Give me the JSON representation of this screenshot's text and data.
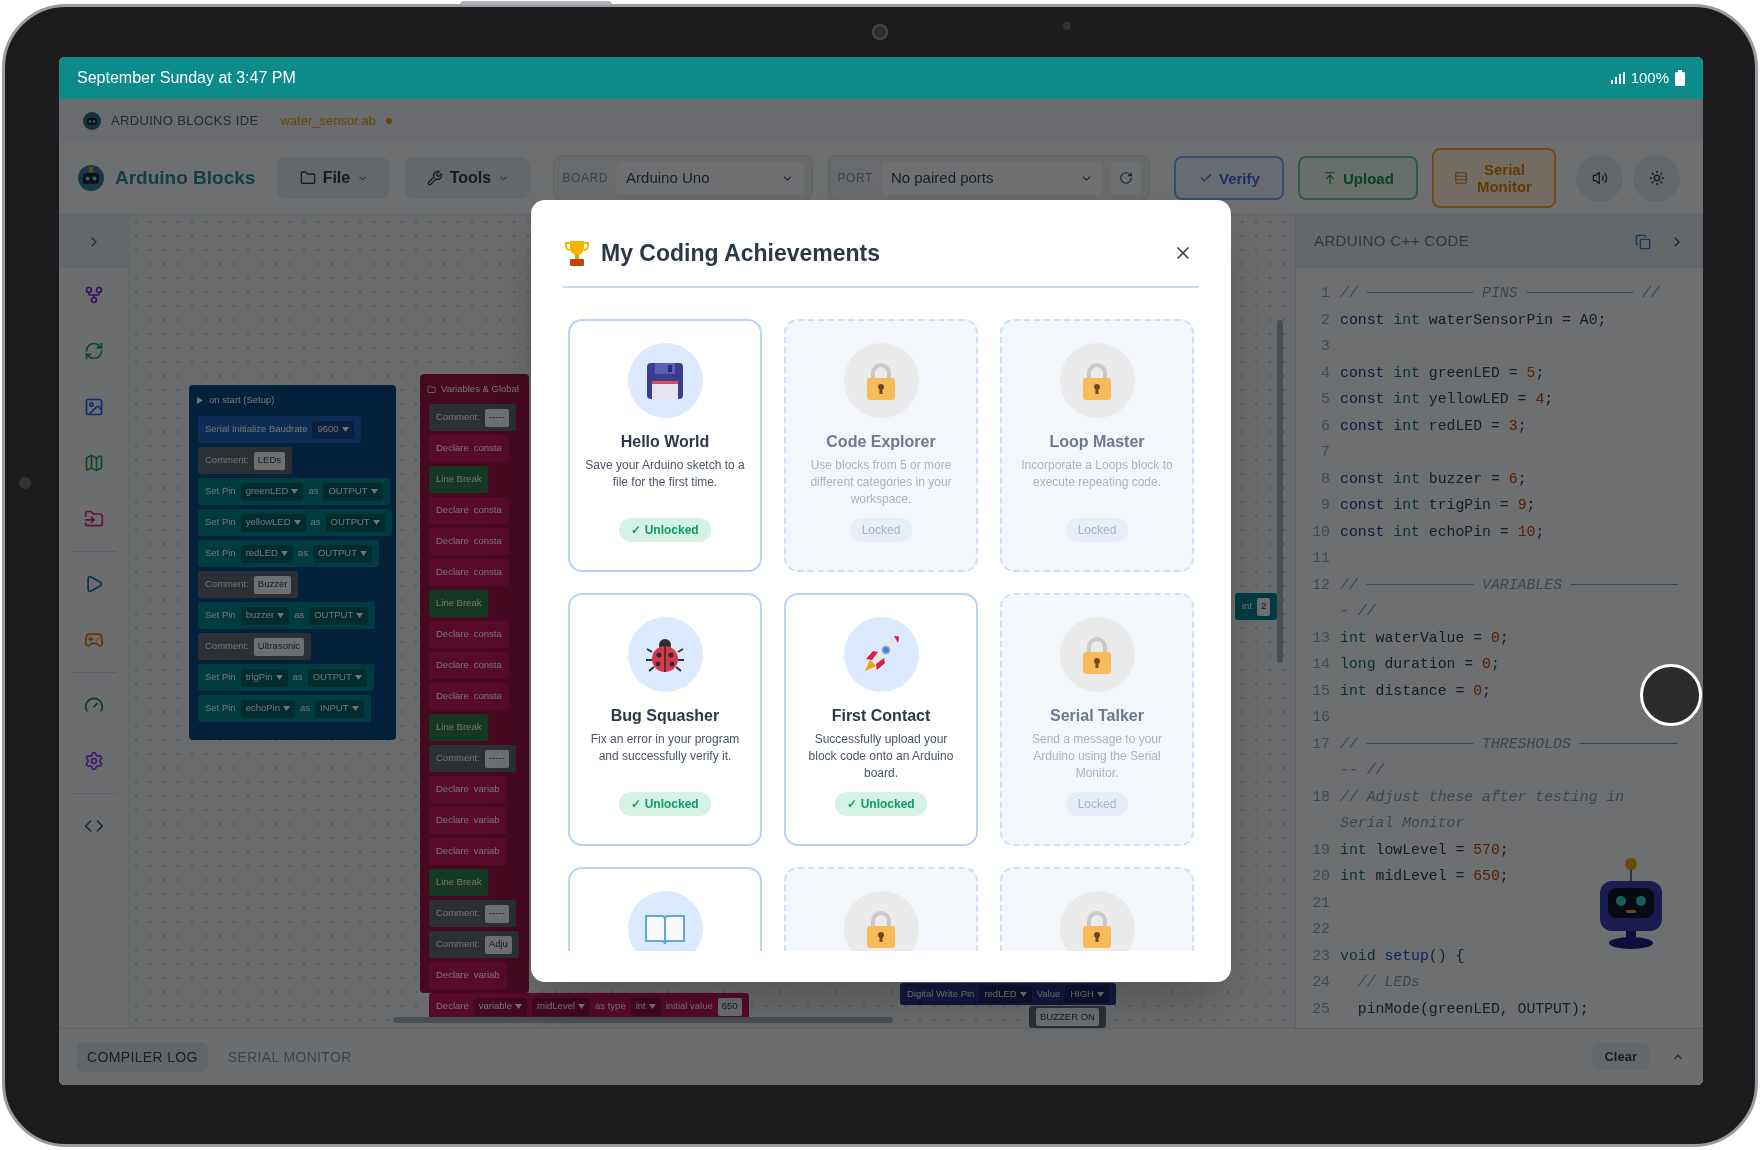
{
  "status_bar": {
    "time": "September Sunday at 3:47 PM",
    "battery": "100%"
  },
  "ide_header": {
    "title": "ARDUINO BLOCKS IDE",
    "file": "water_sensor.ab",
    "modified": true
  },
  "toolbar": {
    "app_name": "Arduino Blocks",
    "menus": [
      {
        "label": "File",
        "kind": "file"
      },
      {
        "label": "Tools",
        "kind": "tools"
      }
    ],
    "board": {
      "label": "BOARD",
      "value": "Arduino Uno"
    },
    "port": {
      "label": "PORT",
      "value": "No paired ports"
    },
    "actions": [
      {
        "label": "Verify",
        "kind": "verify"
      },
      {
        "label": "Upload",
        "kind": "upload"
      },
      {
        "label": "Serial Monitor",
        "kind": "serial"
      }
    ]
  },
  "workspace": {
    "setup_block": {
      "title": "on start (Setup)",
      "rows": [
        {
          "kind": "serial",
          "parts": [
            {
              "text": "Serial Initialize Baudrate"
            },
            {
              "text": "9600",
              "kind": "dropdown"
            }
          ]
        },
        {
          "kind": "comment",
          "parts": [
            {
              "text": "Comment:"
            },
            {
              "text": "LEDs",
              "kind": "field"
            }
          ]
        },
        {
          "kind": "pin",
          "parts": [
            {
              "text": "Set Pin"
            },
            {
              "text": "greenLED",
              "kind": "dropdown"
            },
            {
              "text": "as"
            },
            {
              "text": "OUTPUT",
              "kind": "dropdown"
            }
          ]
        },
        {
          "kind": "pin",
          "parts": [
            {
              "text": "Set Pin"
            },
            {
              "text": "yellowLED",
              "kind": "dropdown"
            },
            {
              "text": "as"
            },
            {
              "text": "OUTPUT",
              "kind": "dropdown"
            }
          ]
        },
        {
          "kind": "pin",
          "parts": [
            {
              "text": "Set Pin"
            },
            {
              "text": "redLED",
              "kind": "dropdown"
            },
            {
              "text": "as"
            },
            {
              "text": "OUTPUT",
              "kind": "dropdown"
            }
          ]
        },
        {
          "kind": "comment",
          "parts": [
            {
              "text": "Comment:"
            },
            {
              "text": "Buzzer",
              "kind": "field"
            }
          ]
        },
        {
          "kind": "pin",
          "parts": [
            {
              "text": "Set Pin"
            },
            {
              "text": "buzzer",
              "kind": "dropdown"
            },
            {
              "text": "as"
            },
            {
              "text": "OUTPUT",
              "kind": "dropdown"
            }
          ]
        },
        {
          "kind": "comment",
          "parts": [
            {
              "text": "Comment:"
            },
            {
              "text": "Ultrasonic",
              "kind": "field"
            }
          ]
        },
        {
          "kind": "pin",
          "parts": [
            {
              "text": "Set Pin"
            },
            {
              "text": "trigPin",
              "kind": "dropdown"
            },
            {
              "text": "as"
            },
            {
              "text": "OUTPUT",
              "kind": "dropdown"
            }
          ]
        },
        {
          "kind": "pin",
          "parts": [
            {
              "text": "Set Pin"
            },
            {
              "text": "echoPin",
              "kind": "dropdown"
            },
            {
              "text": "as"
            },
            {
              "text": "INPUT",
              "kind": "dropdown"
            }
          ]
        }
      ]
    },
    "globals_block": {
      "title": "Variables & Global",
      "rows": [
        {
          "kind": "comment",
          "parts": [
            {
              "text": "Comment:"
            },
            {
              "text": "-----",
              "kind": "field"
            }
          ]
        },
        {
          "kind": "declare",
          "parts": [
            {
              "text": "Declare"
            },
            {
              "text": "consta"
            }
          ]
        },
        {
          "kind": "line_break",
          "parts": [
            {
              "text": "Line Break"
            }
          ]
        },
        {
          "kind": "declare",
          "parts": [
            {
              "text": "Declare"
            },
            {
              "text": "consta"
            }
          ]
        },
        {
          "kind": "declare",
          "parts": [
            {
              "text": "Declare"
            },
            {
              "text": "consta"
            }
          ]
        },
        {
          "kind": "declare",
          "parts": [
            {
              "text": "Declare"
            },
            {
              "text": "consta"
            }
          ]
        },
        {
          "kind": "line_break",
          "parts": [
            {
              "text": "Line Break"
            }
          ]
        },
        {
          "kind": "declare",
          "parts": [
            {
              "text": "Declare"
            },
            {
              "text": "consta"
            }
          ]
        },
        {
          "kind": "declare",
          "parts": [
            {
              "text": "Declare"
            },
            {
              "text": "consta"
            }
          ]
        },
        {
          "kind": "declare",
          "parts": [
            {
              "text": "Declare"
            },
            {
              "text": "consta"
            }
          ]
        },
        {
          "kind": "line_break",
          "parts": [
            {
              "text": "Line Break"
            }
          ]
        },
        {
          "kind": "comment",
          "parts": [
            {
              "text": "Comment:"
            },
            {
              "text": "-----",
              "kind": "field"
            }
          ]
        },
        {
          "kind": "declare",
          "parts": [
            {
              "text": "Declare"
            },
            {
              "text": "variab"
            }
          ]
        },
        {
          "kind": "declare",
          "parts": [
            {
              "text": "Declare"
            },
            {
              "text": "variab"
            }
          ]
        },
        {
          "kind": "declare",
          "parts": [
            {
              "text": "Declare"
            },
            {
              "text": "variab"
            }
          ]
        },
        {
          "kind": "line_break",
          "parts": [
            {
              "text": "Line Break"
            }
          ]
        },
        {
          "kind": "comment",
          "parts": [
            {
              "text": "Comment:"
            },
            {
              "text": "-----",
              "kind": "field"
            }
          ]
        },
        {
          "kind": "comment",
          "parts": [
            {
              "text": "Comment:"
            },
            {
              "text": "Adju",
              "kind": "field"
            }
          ]
        },
        {
          "kind": "declare",
          "parts": [
            {
              "text": "Declare"
            },
            {
              "text": "variab"
            }
          ]
        },
        {
          "kind": "declare",
          "parts": [
            {
              "text": "Declare"
            },
            {
              "text": "variable",
              "kind": "dropdown"
            },
            {
              "text": "midLevel",
              "kind": "dropdown"
            },
            {
              "text": "as type"
            },
            {
              "text": "int",
              "kind": "dropdown"
            },
            {
              "text": "initial value"
            },
            {
              "text": "650",
              "kind": "field"
            }
          ]
        }
      ]
    },
    "loose_blocks": [
      {
        "kind": "output",
        "parts": [
          {
            "text": "Digital Write Pin"
          },
          {
            "text": "redLED",
            "kind": "dropdown"
          },
          {
            "text": "Value"
          },
          {
            "text": "HIGH",
            "kind": "dropdown"
          }
        ]
      },
      {
        "kind": "comment",
        "parts": [
          {
            "text": "BUZZER ON",
            "kind": "field"
          }
        ]
      },
      {
        "kind": "pin",
        "parts": [
          {
            "text": "int"
          },
          {
            "text": "2",
            "kind": "field"
          }
        ]
      }
    ]
  },
  "code_panel": {
    "title": "ARDUINO C++ CODE",
    "lines": [
      {
        "n": "1",
        "tokens": [
          {
            "t": "// ──────────── PINS ──────────── //",
            "kind": "comment"
          }
        ]
      },
      {
        "n": "2",
        "tokens": [
          {
            "t": "const",
            "kind": "kw"
          },
          {
            "t": " int",
            "kind": "type"
          },
          {
            "t": " waterSensorPin = A0;"
          }
        ]
      },
      {
        "n": "3"
      },
      {
        "n": "4",
        "tokens": [
          {
            "t": "const",
            "kind": "kw"
          },
          {
            "t": " int",
            "kind": "type"
          },
          {
            "t": " greenLED = "
          },
          {
            "t": "5",
            "kind": "num"
          },
          {
            "t": ";"
          }
        ]
      },
      {
        "n": "5",
        "tokens": [
          {
            "t": "const",
            "kind": "kw"
          },
          {
            "t": " int",
            "kind": "type"
          },
          {
            "t": " yellowLED = "
          },
          {
            "t": "4",
            "kind": "num"
          },
          {
            "t": ";"
          }
        ]
      },
      {
        "n": "6",
        "tokens": [
          {
            "t": "const",
            "kind": "kw"
          },
          {
            "t": " int",
            "kind": "type"
          },
          {
            "t": " redLED = "
          },
          {
            "t": "3",
            "kind": "num"
          },
          {
            "t": ";"
          }
        ]
      },
      {
        "n": "7"
      },
      {
        "n": "8",
        "tokens": [
          {
            "t": "const",
            "kind": "kw"
          },
          {
            "t": " int",
            "kind": "type"
          },
          {
            "t": " buzzer = "
          },
          {
            "t": "6",
            "kind": "num"
          },
          {
            "t": ";"
          }
        ]
      },
      {
        "n": "9",
        "tokens": [
          {
            "t": "const",
            "kind": "kw"
          },
          {
            "t": " int",
            "kind": "type"
          },
          {
            "t": " trigPin = "
          },
          {
            "t": "9",
            "kind": "num"
          },
          {
            "t": ";"
          }
        ]
      },
      {
        "n": "10",
        "tokens": [
          {
            "t": "const",
            "kind": "kw"
          },
          {
            "t": " int",
            "kind": "type"
          },
          {
            "t": " echoPin = "
          },
          {
            "t": "10",
            "kind": "num"
          },
          {
            "t": ";"
          }
        ]
      },
      {
        "n": "11"
      },
      {
        "n": "12",
        "tokens": [
          {
            "t": "// ──────────── VARIABLES ──────────── - //",
            "kind": "comment"
          }
        ]
      },
      {
        "n": "13",
        "tokens": [
          {
            "t": "int",
            "kind": "type"
          },
          {
            "t": " waterValue = "
          },
          {
            "t": "0",
            "kind": "num"
          },
          {
            "t": ";"
          }
        ]
      },
      {
        "n": "14",
        "tokens": [
          {
            "t": "long",
            "kind": "type"
          },
          {
            "t": " duration = "
          },
          {
            "t": "0",
            "kind": "num"
          },
          {
            "t": ";"
          }
        ]
      },
      {
        "n": "15",
        "tokens": [
          {
            "t": "int",
            "kind": "type"
          },
          {
            "t": " distance = "
          },
          {
            "t": "0",
            "kind": "num"
          },
          {
            "t": ";"
          }
        ]
      },
      {
        "n": "16"
      },
      {
        "n": "17",
        "tokens": [
          {
            "t": "// ──────────── THRESHOLDS ─────────── -- //",
            "kind": "comment"
          }
        ]
      },
      {
        "n": "18",
        "tokens": [
          {
            "t": "// Adjust these after testing in Serial Monitor",
            "kind": "comment"
          }
        ]
      },
      {
        "n": "19",
        "tokens": [
          {
            "t": "int",
            "kind": "type"
          },
          {
            "t": " lowLevel = "
          },
          {
            "t": "570",
            "kind": "num"
          },
          {
            "t": ";"
          }
        ]
      },
      {
        "n": "20",
        "tokens": [
          {
            "t": "int",
            "kind": "type"
          },
          {
            "t": " midLevel = "
          },
          {
            "t": "650",
            "kind": "num"
          },
          {
            "t": ";"
          }
        ]
      },
      {
        "n": "21"
      },
      {
        "n": "22"
      },
      {
        "n": "23",
        "tokens": [
          {
            "t": "void",
            "kind": "type"
          },
          {
            "t": " setup",
            "kind": "fn"
          },
          {
            "t": "() {"
          }
        ]
      },
      {
        "n": "24",
        "tokens": [
          {
            "t": "  // LEDs",
            "kind": "comment"
          }
        ]
      },
      {
        "n": "25",
        "tokens": [
          {
            "t": "  pinMode(greenLED, OUTPUT);"
          }
        ]
      }
    ]
  },
  "bottom_panel": {
    "tabs": [
      {
        "label": "COMPILER LOG",
        "selected": true
      },
      {
        "label": "SERIAL MONITOR",
        "selected": false
      }
    ],
    "clear": "Clear"
  },
  "achievements_modal": {
    "title": "My Coding Achievements",
    "achievements": [
      {
        "title": "Hello World",
        "description": "Save your Arduino sketch to a file for the first time.",
        "status": "✓ Unlocked",
        "unlocked": true,
        "kind": "floppy"
      },
      {
        "title": "Code Explorer",
        "description": "Use blocks from 5 or more different categories in your workspace.",
        "status": "Locked",
        "unlocked": false
      },
      {
        "title": "Loop Master",
        "description": "Incorporate a Loops block to execute repeating code.",
        "status": "Locked",
        "unlocked": false
      },
      {
        "title": "Bug Squasher",
        "description": "Fix an error in your program and successfully verify it.",
        "status": "✓ Unlocked",
        "unlocked": true,
        "kind": "ladybug"
      },
      {
        "title": "First Contact",
        "description": "Successfully upload your block code onto an Arduino board.",
        "status": "✓ Unlocked",
        "unlocked": true,
        "kind": "rocket"
      },
      {
        "title": "Serial Talker",
        "description": "Send a message to your Arduino using the Serial Monitor.",
        "status": "Locked",
        "unlocked": false
      },
      {
        "unlocked": true,
        "kind": "book"
      },
      {
        "unlocked": false
      },
      {
        "unlocked": false
      }
    ]
  }
}
